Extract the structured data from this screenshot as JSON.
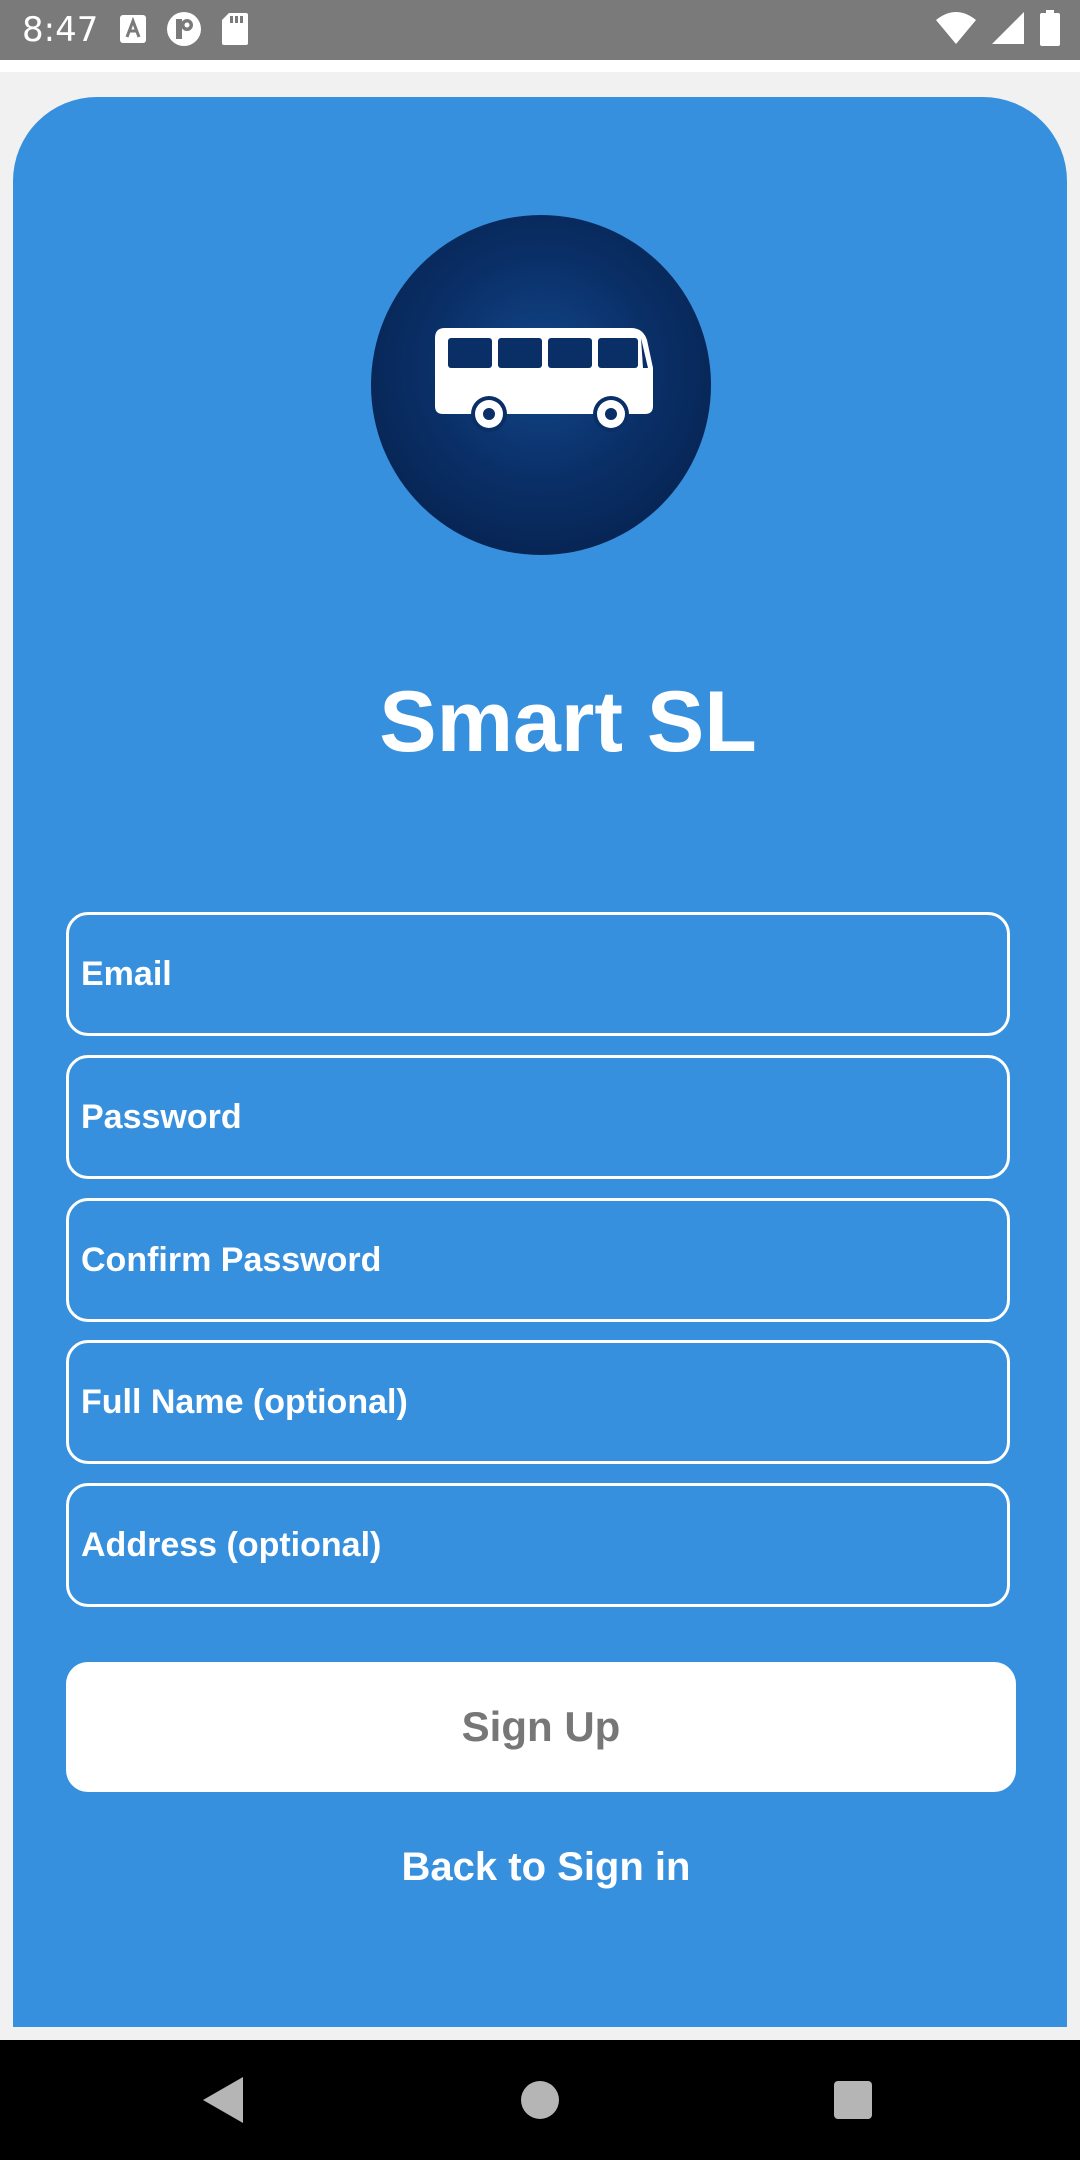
{
  "status_bar": {
    "time": "8:47",
    "left_icons": [
      "a-badge-icon",
      "p-circle-icon",
      "sd-card-icon"
    ],
    "right_icons": [
      "wifi-icon",
      "signal-icon",
      "battery-icon"
    ]
  },
  "app": {
    "logo_icon": "bus-icon",
    "title": "Smart SL"
  },
  "form": {
    "email_placeholder": "Email",
    "password_placeholder": "Password",
    "confirm_password_placeholder": "Confirm Password",
    "full_name_placeholder": "Full Name (optional)",
    "address_placeholder": "Address (optional)",
    "signup_label": "Sign Up",
    "back_label": "Back to Sign in"
  },
  "nav_bar": {
    "icons": [
      "back-triangle-icon",
      "home-circle-icon",
      "recents-square-icon"
    ]
  },
  "colors": {
    "card_background": "#3790de",
    "logo_background": "#0a2f67",
    "status_bar": "#7a7a7a",
    "button_text": "#777777"
  }
}
